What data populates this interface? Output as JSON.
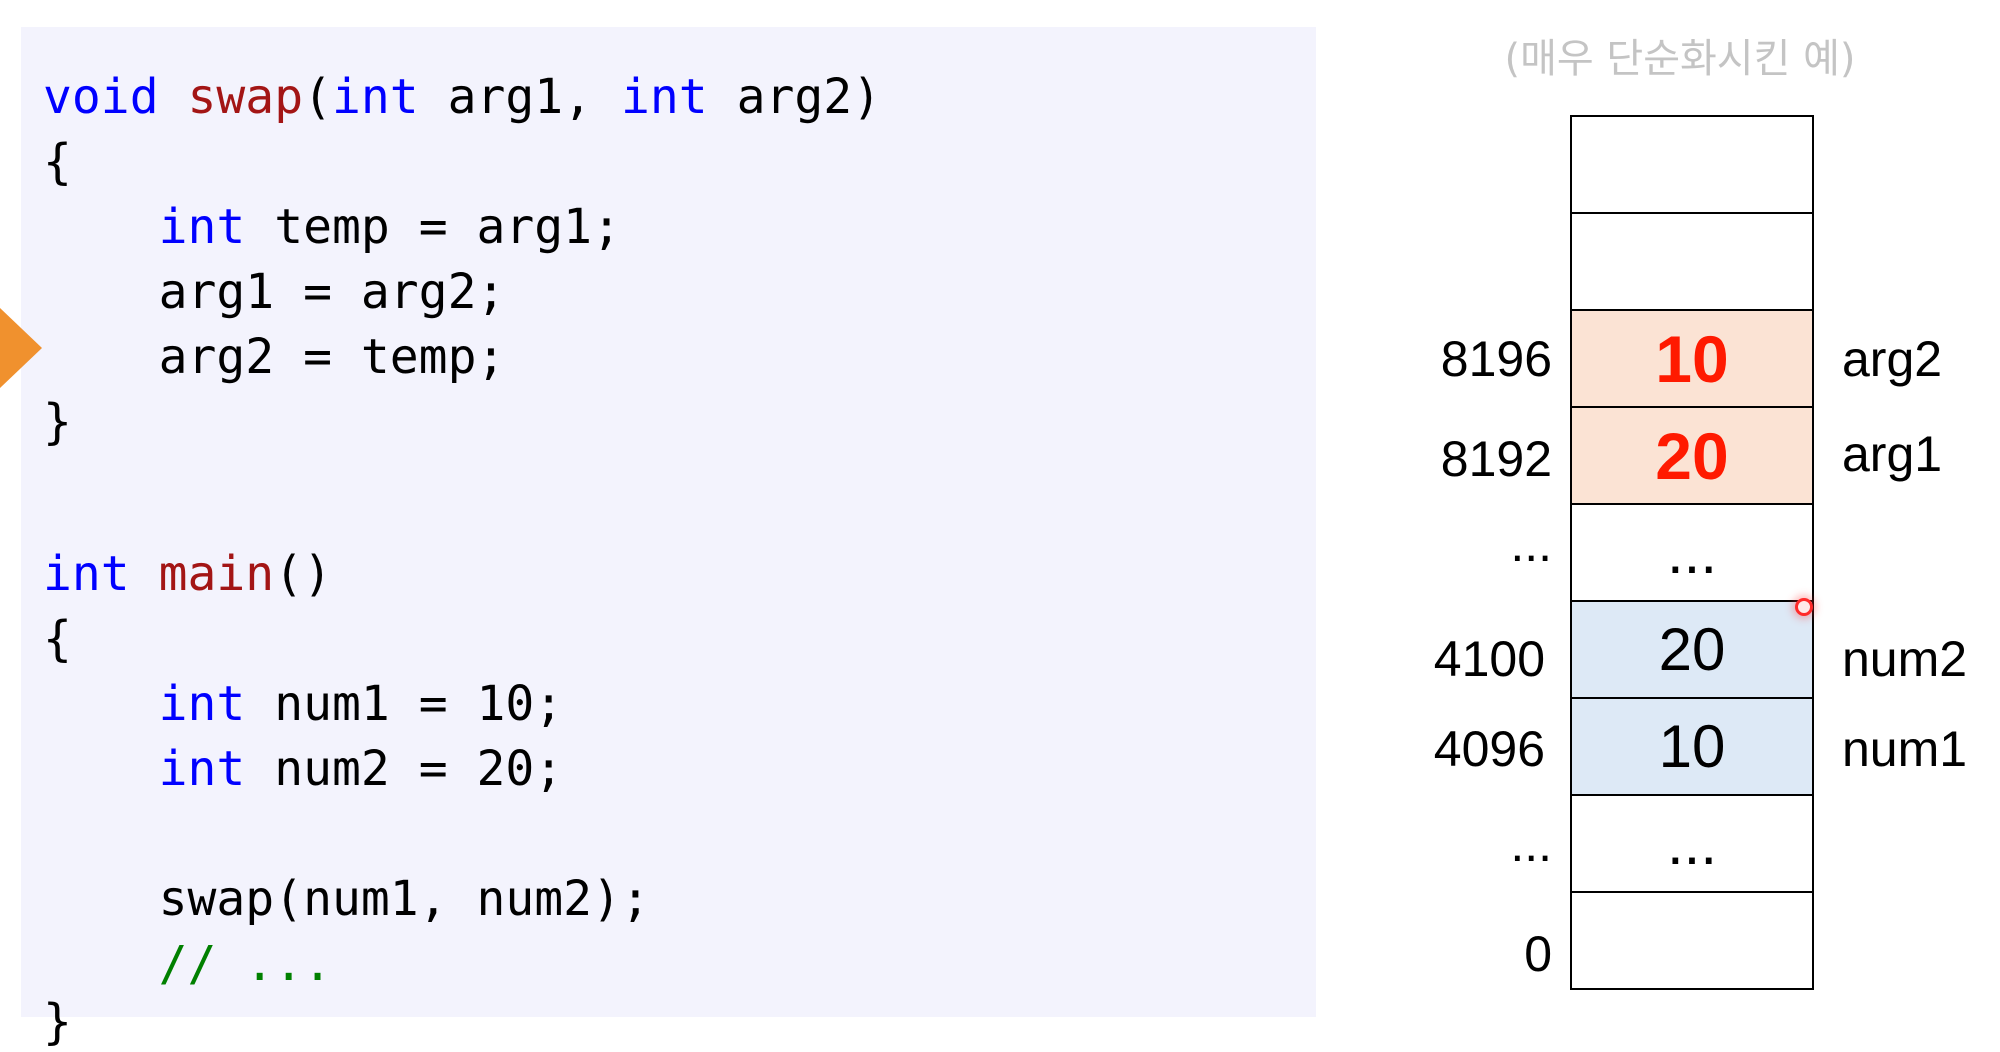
{
  "caption": "(매우 단순화시킨 예)",
  "code": {
    "l1_kw1": "void",
    "l1_fn": "swap",
    "l1_p1": "(",
    "l1_kw2": "int",
    "l1_p2": " arg1, ",
    "l1_kw3": "int",
    "l1_p3": " arg2)",
    "l2": "{",
    "l3_kw": "int",
    "l3_rest": " temp = arg1;",
    "l4": "arg1 = arg2;",
    "l5": "arg2 = temp;",
    "l6": "}",
    "l7_kw": "int",
    "l7_fn": "main",
    "l7_rest": "()",
    "l8": "{",
    "l9_kw": "int",
    "l9_rest": " num1 = 10;",
    "l10_kw": "int",
    "l10_rest": " num2 = 20;",
    "l11": "swap(num1, num2);",
    "l12": "// ...",
    "l13": "}"
  },
  "memory": {
    "cells": [
      "",
      "",
      "10",
      "20",
      "...",
      "20",
      "10",
      "...",
      ""
    ],
    "addresses": [
      "8196",
      "8192",
      "...",
      "4100",
      "4096",
      "...",
      "0"
    ],
    "names": [
      "arg2",
      "arg1",
      "num2",
      "num1"
    ]
  },
  "colors": {
    "keyword": "#0000ff",
    "function": "#a31515",
    "comment": "#008000",
    "highlight_value": "#ff1a00",
    "arg_cell_bg": "#fbe3d4",
    "num_cell_bg": "#dde9f6",
    "pointer": "#f0912e"
  }
}
